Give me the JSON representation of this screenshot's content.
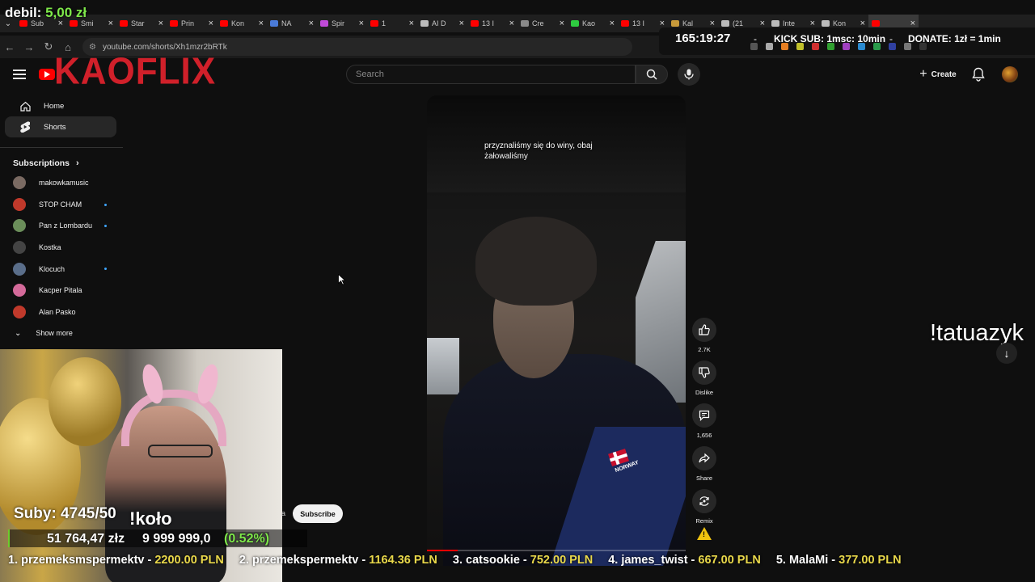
{
  "overlay": {
    "donor_name": "debil:",
    "donor_amount": "5,00 zł",
    "timer": "165:19:27",
    "kick_sub": "KICK SUB: 1msc: 10min",
    "donate": "DONATE: 1zł = 1min",
    "tatuazyk": "!tatuazyk",
    "kolo": "!koło",
    "subs_goal": "Suby: 4745/50",
    "goal_current": "51 764,47 złz",
    "goal_target": "9 999 999,0",
    "goal_percent": "(0.52%)",
    "goal_fraction": 0.0052,
    "ticker": [
      {
        "rank": "1.",
        "name": "przemeksmspermektv",
        "amount": "2200.00 PLN"
      },
      {
        "rank": "2.",
        "name": "przemekspermektv",
        "amount": "1164.36 PLN"
      },
      {
        "rank": "3.",
        "name": "catsookie",
        "amount": "752.00 PLN"
      },
      {
        "rank": "4.",
        "name": "james_twist",
        "amount": "667.00 PLN"
      },
      {
        "rank": "5.",
        "name": "MalaMi",
        "amount": "377.00 PLN"
      }
    ]
  },
  "browser": {
    "tabs": [
      {
        "title": "Sub",
        "color": "#ff0000"
      },
      {
        "title": "Smi",
        "color": "#ff0000"
      },
      {
        "title": "Star",
        "color": "#ff0000"
      },
      {
        "title": "Prin",
        "color": "#ff0000"
      },
      {
        "title": "Kon",
        "color": "#ff0000"
      },
      {
        "title": "NA",
        "color": "#4a7bd8"
      },
      {
        "title": "Spir",
        "color": "#c04ad8"
      },
      {
        "title": "1",
        "color": "#ff0000"
      },
      {
        "title": "AI D",
        "color": "#bbbbbb"
      },
      {
        "title": "13 I",
        "color": "#ff0000"
      },
      {
        "title": "Cre",
        "color": "#8a8a8a"
      },
      {
        "title": "Kao",
        "color": "#2ecc40"
      },
      {
        "title": "13 I",
        "color": "#ff0000"
      },
      {
        "title": "Kal",
        "color": "#c89a3a"
      },
      {
        "title": "(21",
        "color": "#bbbbbb"
      },
      {
        "title": "Inte",
        "color": "#bbbbbb"
      },
      {
        "title": "Kon",
        "color": "#bbbbbb"
      },
      {
        "title": "",
        "color": "#ff0000"
      }
    ],
    "url": "youtube.com/shorts/Xh1mzr2bRTk"
  },
  "header": {
    "logo_text": "KAOFLIX",
    "search_placeholder": "Search",
    "create_label": "Create"
  },
  "sidebar": {
    "home": "Home",
    "shorts": "Shorts",
    "subscriptions_title": "Subscriptions",
    "subscriptions": [
      {
        "name": "makowkamusic",
        "avatar_color": "#7a6a62",
        "new": false
      },
      {
        "name": "STOP CHAM",
        "avatar_color": "#c0392b",
        "new": true
      },
      {
        "name": "Pan z Lombardu",
        "avatar_color": "#6b8e5a",
        "new": true
      },
      {
        "name": "Kostka",
        "avatar_color": "#444444",
        "new": false
      },
      {
        "name": "Klocuch",
        "avatar_color": "#5a6e8a",
        "new": true
      },
      {
        "name": "Kacper Pitala",
        "avatar_color": "#d46a9a",
        "new": false
      },
      {
        "name": "Alan Pasko",
        "avatar_color": "#c0392b",
        "new": false
      }
    ],
    "show_more": "Show more"
  },
  "short": {
    "caption": "przyznaliśmy się do winy, obaj żałowaliśmy",
    "jacket_text": "NORWAY",
    "progress_fraction": 0.12
  },
  "actions": {
    "likes": "2.7K",
    "dislike": "Dislike",
    "comments": "1,656",
    "share": "Share",
    "remix": "Remix"
  },
  "channel": {
    "subscribe": "Subscribe",
    "name_fragment": "a"
  }
}
